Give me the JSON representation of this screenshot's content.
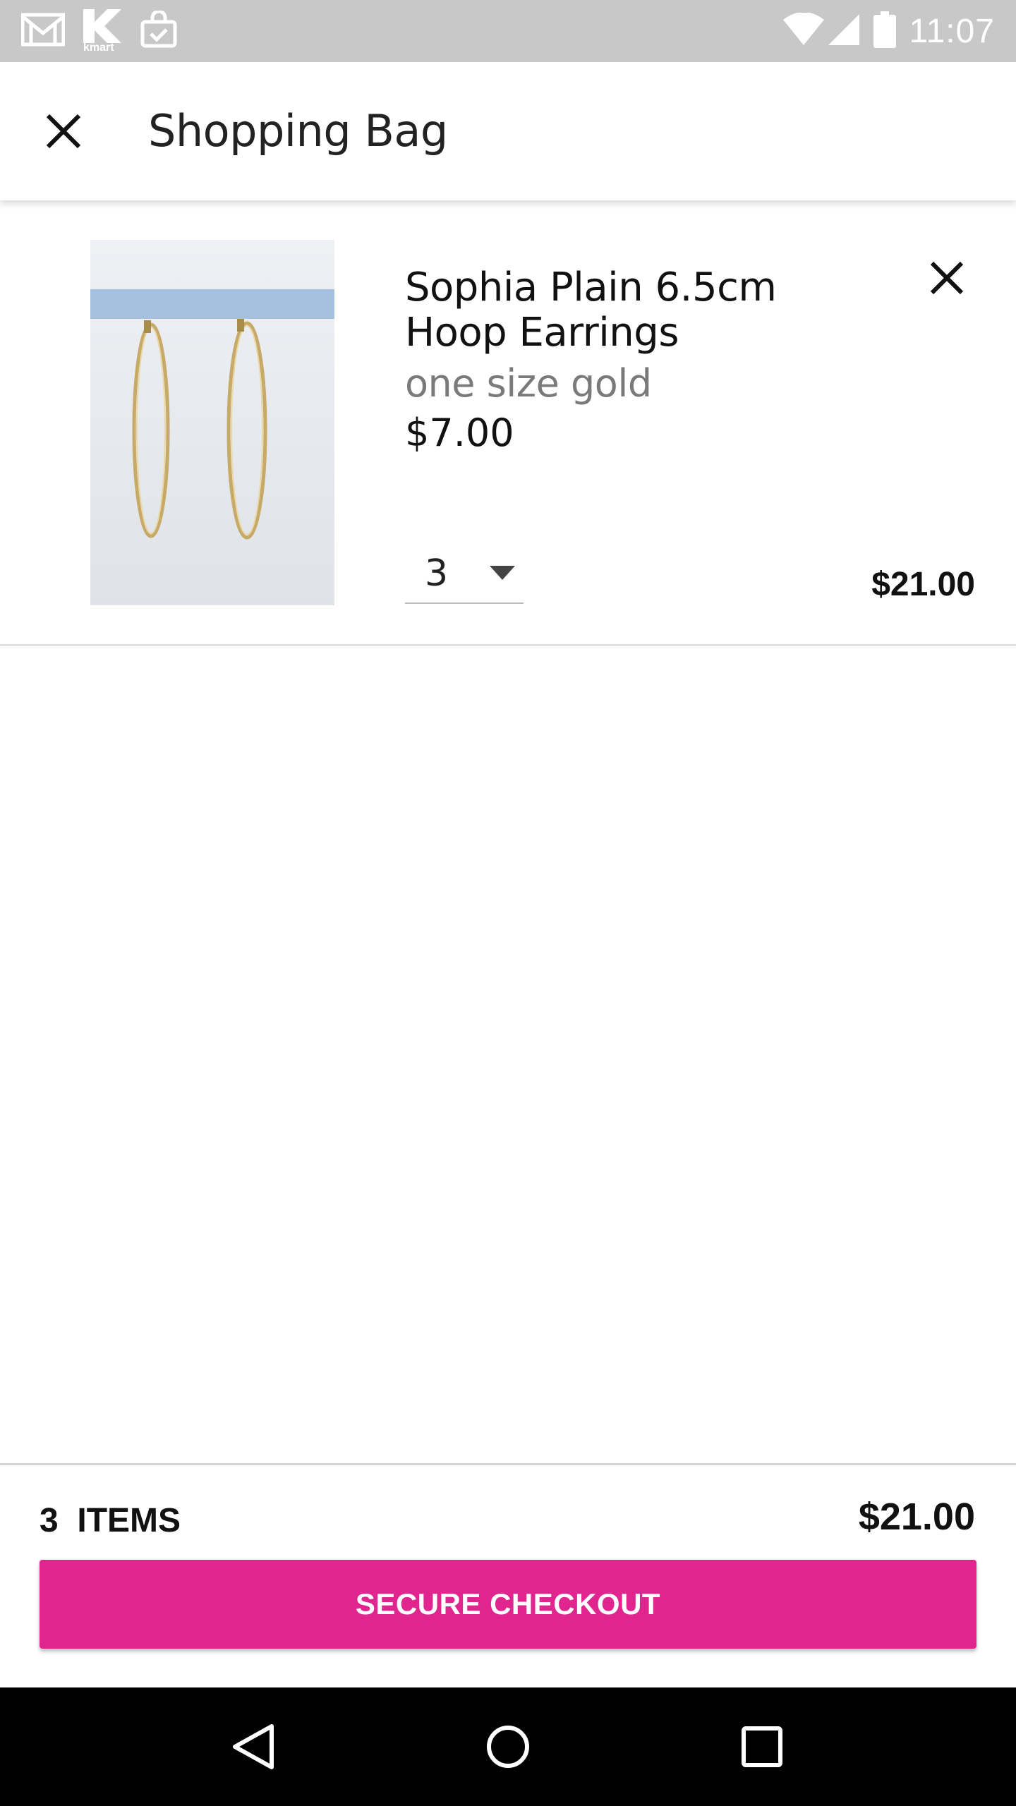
{
  "status_bar": {
    "time": "11:07",
    "notification_icons": [
      "gmail-icon",
      "kmart-icon",
      "shopping-bag-check-icon"
    ],
    "kmart_logo_text": "kmart",
    "system_icons": [
      "wifi-icon",
      "signal-icon",
      "battery-icon"
    ]
  },
  "header": {
    "title": "Shopping Bag",
    "close_icon": "close-icon"
  },
  "cart": {
    "items": [
      {
        "name": "Sophia Plain 6.5cm Hoop Earrings",
        "variant": "one size gold",
        "unit_price": "$7.00",
        "quantity": "3",
        "line_total": "$21.00",
        "remove_icon": "close-icon"
      }
    ]
  },
  "summary": {
    "items_count": "3  ITEMS",
    "total": "$21.00",
    "checkout_label": "SECURE CHECKOUT"
  },
  "colors": {
    "accent": "#e1258f",
    "status_bar": "#c8c8c8",
    "nav_bar": "#000000"
  },
  "nav_bar": {
    "buttons": [
      "back-icon",
      "home-icon",
      "recents-icon"
    ]
  }
}
